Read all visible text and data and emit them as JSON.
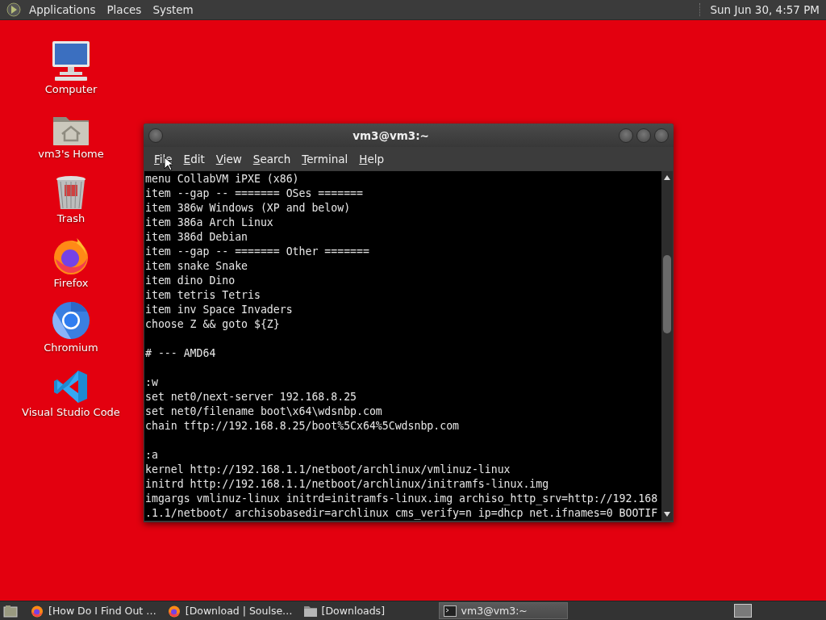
{
  "top_panel": {
    "menus": [
      "Applications",
      "Places",
      "System"
    ],
    "clock": "Sun Jun 30, 4:57 PM"
  },
  "desktop_icons": [
    {
      "label": "Computer",
      "kind": "computer"
    },
    {
      "label": "vm3's Home",
      "kind": "home"
    },
    {
      "label": "Trash",
      "kind": "trash"
    },
    {
      "label": "Firefox",
      "kind": "firefox"
    },
    {
      "label": "Chromium",
      "kind": "chromium"
    },
    {
      "label": "Visual Studio Code",
      "kind": "vscode"
    }
  ],
  "terminal_window": {
    "title": "vm3@vm3:~",
    "menu": [
      "File",
      "Edit",
      "View",
      "Search",
      "Terminal",
      "Help"
    ],
    "blocks": [
      [
        "menu CollabVM iPXE (x86)",
        "item --gap -- ======= OSes =======",
        "item 386w Windows (XP and below)",
        "item 386a Arch Linux",
        "item 386d Debian",
        "item --gap -- ======= Other =======",
        "item snake Snake",
        "item dino Dino",
        "item tetris Tetris",
        "item inv Space Invaders",
        "choose Z && goto ${Z}"
      ],
      [
        "# --- AMD64"
      ],
      [
        ":w",
        "set net0/next-server 192.168.8.25",
        "set net0/filename boot\\x64\\wdsnbp.com",
        "chain tftp://192.168.8.25/boot%5Cx64%5Cwdsnbp.com"
      ],
      [
        ":a",
        "kernel http://192.168.1.1/netboot/archlinux/vmlinuz-linux",
        "initrd http://192.168.1.1/netboot/archlinux/initramfs-linux.img",
        "imgargs vmlinuz-linux initrd=initramfs-linux.img archiso_http_srv=http://192.168",
        ".1.1/netboot/ archisobasedir=archlinux cms_verify=n ip=dhcp net.ifnames=0 BOOTIF"
      ]
    ]
  },
  "taskbar": {
    "tasks": [
      {
        "label": "[How Do I Find Out …",
        "kind": "browser",
        "selected": false
      },
      {
        "label": "[Download | Soulse…",
        "kind": "browser",
        "selected": false
      },
      {
        "label": "[Downloads]",
        "kind": "folder",
        "selected": false
      },
      {
        "label": "vm3@vm3:~",
        "kind": "terminal",
        "selected": true
      }
    ]
  }
}
